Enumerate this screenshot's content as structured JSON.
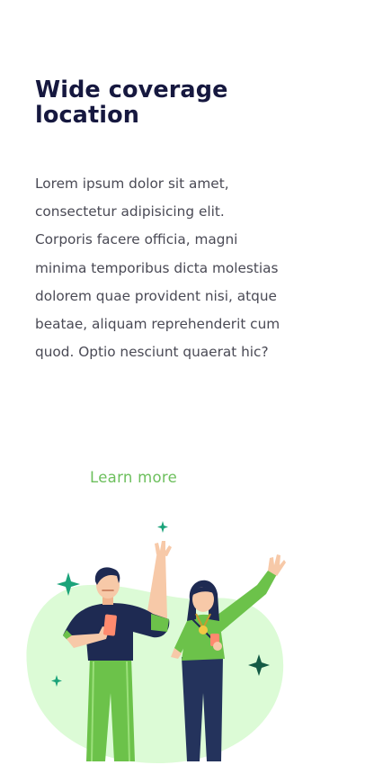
{
  "section": {
    "title": "Wide coverage location",
    "body": "Lorem ipsum dolor sit amet, consectetur adipisicing elit. Corporis facere officia, magni minima temporibus dicta molestias dolorem quae provident nisi, atque beatae, aliquam reprehenderit cum quod. Optio nesciunt quaerat hic?",
    "link_label": "Learn more"
  },
  "colors": {
    "title": "#16183f",
    "body_text": "#4a4a55",
    "accent": "#6cbf5c",
    "blob": "#dcfbd6",
    "sparkle": "#1ba37a",
    "navy": "#24335c"
  },
  "illustration": {
    "icon": "people-celebrating-illustration"
  }
}
